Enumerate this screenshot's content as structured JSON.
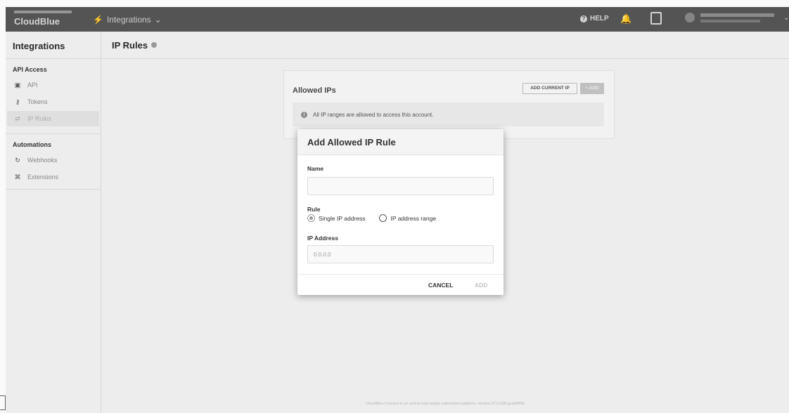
{
  "topbar": {
    "logo_text": "CloudBlue",
    "product_label": "Integrations",
    "help_label": "HELP"
  },
  "sidebar": {
    "title": "Integrations",
    "sections": [
      {
        "title": "API Access",
        "items": [
          {
            "label": "API",
            "icon": "key-card-icon"
          },
          {
            "label": "Tokens",
            "icon": "key-icon"
          },
          {
            "label": "IP Rules",
            "icon": "ip-rules-icon",
            "active": true
          }
        ]
      },
      {
        "title": "Automations",
        "items": [
          {
            "label": "Webhooks",
            "icon": "webhook-icon"
          },
          {
            "label": "Extensions",
            "icon": "extension-icon"
          }
        ]
      }
    ]
  },
  "main": {
    "page_title": "IP Rules",
    "card": {
      "title": "Allowed IPs",
      "add_current_label": "ADD CURRENT IP",
      "add_label": "+ ADD",
      "info_text": "All IP ranges are allowed to access this account."
    },
    "footer": "CloudBlue Connect is an end-to-end supply automation platform, version 37.0.235-gca0846b"
  },
  "dialog": {
    "title": "Add Allowed IP Rule",
    "name_label": "Name",
    "name_value": "",
    "rule_label": "Rule",
    "rule_options": [
      "Single IP address",
      "IP address range"
    ],
    "rule_selected": "Single IP address",
    "ip_label": "IP Address",
    "ip_placeholder": "0.0.0.0",
    "cancel_label": "CANCEL",
    "add_label": "ADD"
  }
}
